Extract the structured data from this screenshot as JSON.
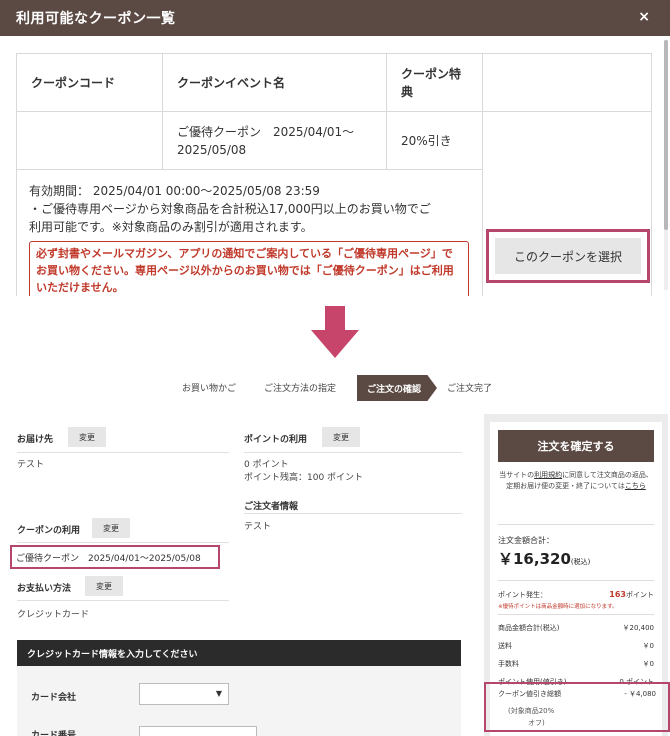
{
  "modal": {
    "title": "利用可能なクーポン一覧",
    "close": "×",
    "table": {
      "headers": [
        "クーポンコード",
        "クーポンイベント名",
        "クーポン特典"
      ],
      "row": {
        "code": "",
        "event": "ご優待クーポン　2025/04/01～2025/05/08",
        "benefit": "20%引き"
      },
      "validity": "有効期間： 2025/04/01 00:00～2025/05/08 23:59",
      "condition1": "・ご優待専用ページから対象商品を合計税込17,000円以上のお買い物でご",
      "condition2": "利用可能です。※対象商品のみ割引が適用されます。",
      "notice": "必ず封書やメールマガジン、アプリの通知でご案内している「ご優待専用ページ」でお買い物ください。専用ページ以外からのお買い物では「ご優待クーポン」はご利用いただけません。"
    },
    "select_button": "このクーポンを選択"
  },
  "steps": [
    "お買い物かご",
    "ご注文方法の指定",
    "ご注文の確認",
    "ご注文完了"
  ],
  "order": {
    "change": "変更",
    "delivery_label": "お届け先",
    "delivery_value": "テスト",
    "points_label": "ポイントの利用",
    "points_used": "0 ポイント",
    "points_balance": "ポイント残高：100 ポイント",
    "orderer_label": "ご注文者情報",
    "orderer_value": "テスト",
    "coupon_label": "クーポンの利用",
    "coupon_value": "ご優待クーポン　2025/04/01～2025/05/08",
    "payment_label": "お支払い方法",
    "payment_value": "クレジットカード",
    "cc_header": "クレジットカード情報を入力してください",
    "cc_company": "カード会社",
    "cc_number": "カード番号"
  },
  "summary": {
    "confirm_button": "注文を確定する",
    "terms_pre": "当サイトの",
    "terms_link": "利用規約",
    "terms_mid": "に同意して注文商品の返品、定期お届け便の変更・終了については",
    "terms_link2": "こちら",
    "total_label": "注文金額合計：",
    "total_value": "￥16,320",
    "total_tax": "(税込)",
    "points_earn_label": "ポイント発生：",
    "points_earn_value": "163",
    "points_unit": "ポイント",
    "points_note": "※優待ポイントは商品金額時に適加になります。",
    "rows": [
      {
        "label": "商品金額合計(税込)",
        "value": "￥20,400"
      },
      {
        "label": "送料",
        "value": "￥0"
      },
      {
        "label": "手数料",
        "value": "￥0"
      },
      {
        "label": "ポイント使用(値引き)",
        "value": "0 ポイント"
      }
    ],
    "discount_label": "クーポン値引き総額",
    "discount_value": "- ￥4,080",
    "discount_note1": "(対象商品20%",
    "discount_note2": "オフ)"
  },
  "colors": {
    "brand": "#5b4a43",
    "highlight": "#b5476d",
    "notice": "#c0392b",
    "arrow": "#c7446a"
  }
}
